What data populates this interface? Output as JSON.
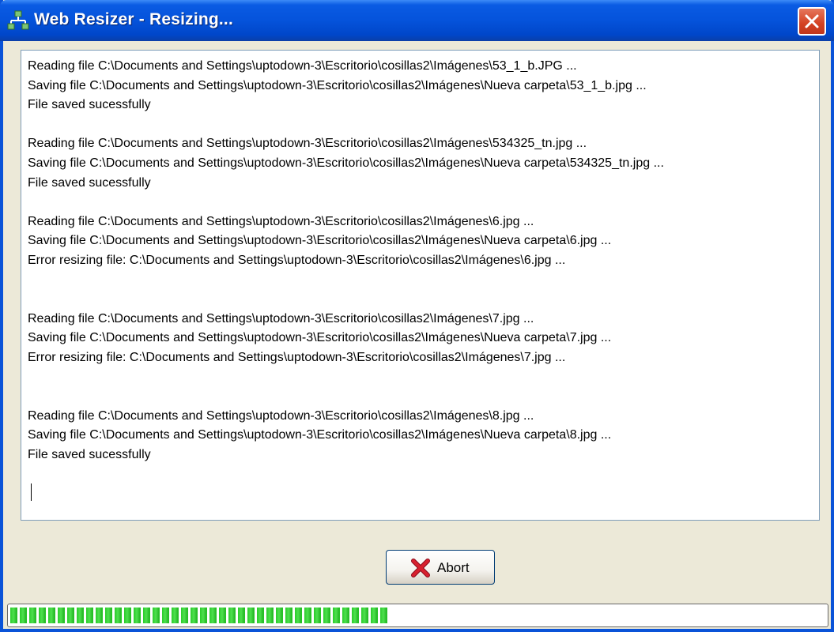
{
  "window": {
    "title": "Web Resizer - Resizing..."
  },
  "icons": {
    "app": "network-tree-icon",
    "close": "close-icon",
    "abort": "red-x-icon"
  },
  "colors": {
    "titlebar": "#0553DB",
    "close_button": "#D44122",
    "abort_icon": "#C8102E",
    "progress_fill": "#2ACB2A"
  },
  "log": {
    "lines": [
      "Reading file C:\\Documents and Settings\\uptodown-3\\Escritorio\\cosillas2\\Imágenes\\53_1_b.JPG ...",
      "Saving file C:\\Documents and Settings\\uptodown-3\\Escritorio\\cosillas2\\Imágenes\\Nueva carpeta\\53_1_b.jpg ...",
      "File saved sucessfully",
      "",
      "Reading file C:\\Documents and Settings\\uptodown-3\\Escritorio\\cosillas2\\Imágenes\\534325_tn.jpg ...",
      "Saving file C:\\Documents and Settings\\uptodown-3\\Escritorio\\cosillas2\\Imágenes\\Nueva carpeta\\534325_tn.jpg ...",
      "File saved sucessfully",
      "",
      "Reading file C:\\Documents and Settings\\uptodown-3\\Escritorio\\cosillas2\\Imágenes\\6.jpg ...",
      "Saving file C:\\Documents and Settings\\uptodown-3\\Escritorio\\cosillas2\\Imágenes\\Nueva carpeta\\6.jpg ...",
      "Error resizing file: C:\\Documents and Settings\\uptodown-3\\Escritorio\\cosillas2\\Imágenes\\6.jpg ...",
      "",
      "",
      "Reading file C:\\Documents and Settings\\uptodown-3\\Escritorio\\cosillas2\\Imágenes\\7.jpg ...",
      "Saving file C:\\Documents and Settings\\uptodown-3\\Escritorio\\cosillas2\\Imágenes\\Nueva carpeta\\7.jpg ...",
      "Error resizing file: C:\\Documents and Settings\\uptodown-3\\Escritorio\\cosillas2\\Imágenes\\7.jpg ...",
      "",
      "",
      "Reading file C:\\Documents and Settings\\uptodown-3\\Escritorio\\cosillas2\\Imágenes\\8.jpg ...",
      "Saving file C:\\Documents and Settings\\uptodown-3\\Escritorio\\cosillas2\\Imágenes\\Nueva carpeta\\8.jpg ...",
      "File saved sucessfully"
    ]
  },
  "buttons": {
    "abort_label": "Abort"
  },
  "progress": {
    "fraction": 0.465
  }
}
